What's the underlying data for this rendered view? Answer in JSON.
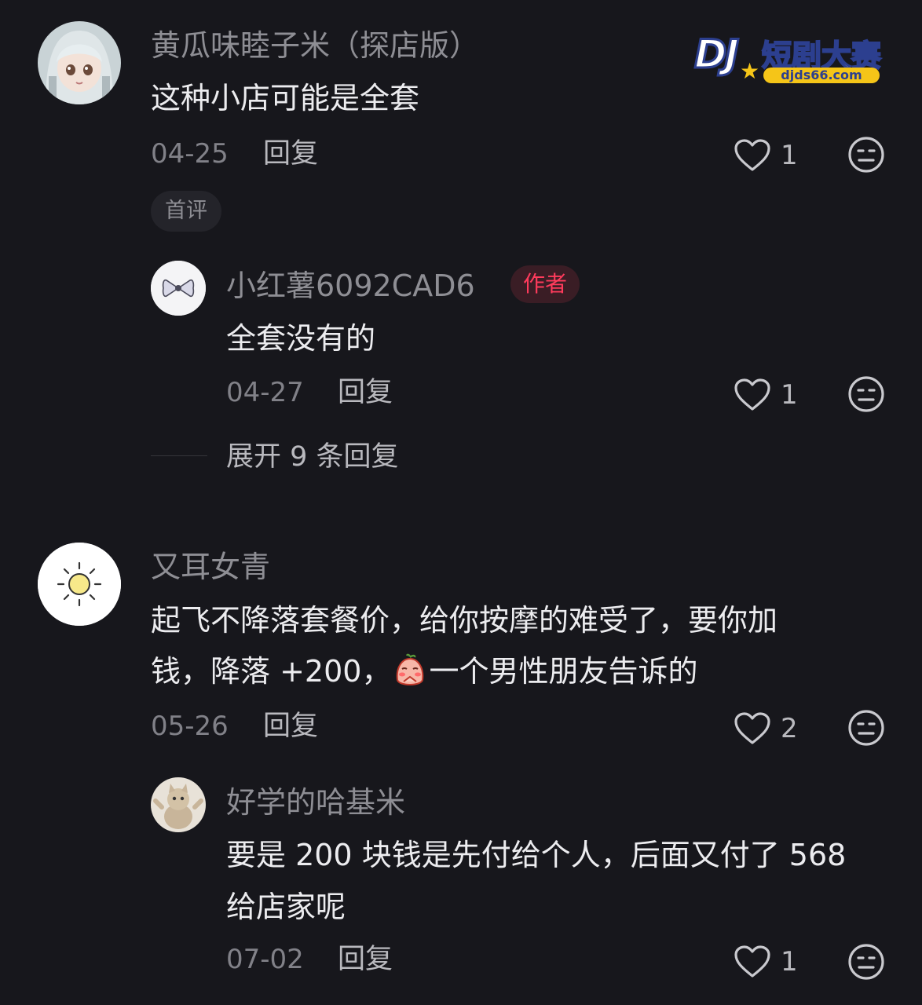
{
  "watermark": {
    "logo_text": "DJ",
    "title": "短剧大赛",
    "domain": "djds66.com"
  },
  "comments": [
    {
      "username": "黄瓜味睦子米（探店版）",
      "text": "这种小店可能是全套",
      "date": "04-25",
      "reply_label": "回复",
      "likes": "1",
      "tag": "首评",
      "avatar": "anime-girl-avatar",
      "replies": [
        {
          "username": "小红薯6092CAD6",
          "badge": "作者",
          "text": "全套没有的",
          "date": "04-27",
          "reply_label": "回复",
          "likes": "1",
          "avatar": "bow-avatar"
        }
      ],
      "expand_label": "展开 9 条回复"
    },
    {
      "username": "又耳女青",
      "text_line1": "起飞不降落套餐价，给你按摩的难受了，要你加",
      "text_line2_part1": "钱，降落 +200，",
      "text_line2_part2": "一个男性朋友告诉的",
      "inline_emoji": "shy-face-emoji",
      "date": "05-26",
      "reply_label": "回复",
      "likes": "2",
      "avatar": "sun-avatar",
      "replies": [
        {
          "username": "好学的哈基米",
          "text_line1": "要是 200 块钱是先付给个人，后面又付了 568",
          "text_line2": "给店家呢",
          "date": "07-02",
          "reply_label": "回复",
          "likes": "1",
          "avatar": "cat-avatar"
        }
      ]
    }
  ],
  "colors": {
    "background": "#17171c",
    "author_badge": "#ff3b5c",
    "username": "#8e8e94",
    "text": "#ececef"
  }
}
